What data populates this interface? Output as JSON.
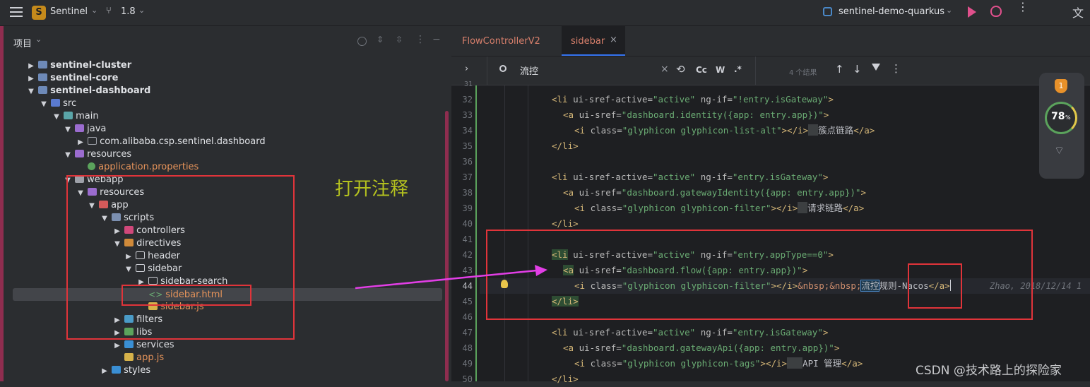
{
  "topbar": {
    "project": "Sentinel",
    "branch": "1.8",
    "run_config": "sentinel-demo-quarkus"
  },
  "project_panel": {
    "title": "项目",
    "tree": [
      {
        "label": "sentinel-cluster",
        "kind": "module"
      },
      {
        "label": "sentinel-core",
        "kind": "module"
      },
      {
        "label": "sentinel-dashboard",
        "kind": "module"
      },
      {
        "label": "src",
        "kind": "folder"
      },
      {
        "label": "main",
        "kind": "folder"
      },
      {
        "label": "java",
        "kind": "folder"
      },
      {
        "label": "com.alibaba.csp.sentinel.dashboard",
        "kind": "package"
      },
      {
        "label": "resources",
        "kind": "folder"
      },
      {
        "label": "application.properties",
        "kind": "file"
      },
      {
        "label": "webapp",
        "kind": "folder"
      },
      {
        "label": "resources",
        "kind": "folder"
      },
      {
        "label": "app",
        "kind": "folder"
      },
      {
        "label": "scripts",
        "kind": "folder"
      },
      {
        "label": "controllers",
        "kind": "folder"
      },
      {
        "label": "directives",
        "kind": "folder"
      },
      {
        "label": "header",
        "kind": "folder"
      },
      {
        "label": "sidebar",
        "kind": "folder"
      },
      {
        "label": "sidebar-search",
        "kind": "folder"
      },
      {
        "label": "sidebar.html",
        "kind": "file"
      },
      {
        "label": "sidebar.js",
        "kind": "file"
      },
      {
        "label": "filters",
        "kind": "folder"
      },
      {
        "label": "libs",
        "kind": "folder"
      },
      {
        "label": "services",
        "kind": "folder"
      },
      {
        "label": "app.js",
        "kind": "file"
      },
      {
        "label": "styles",
        "kind": "folder"
      }
    ]
  },
  "annotation": {
    "note": "打开注释"
  },
  "editor": {
    "tabs": [
      "FlowControllerV2",
      "sidebar"
    ],
    "find": {
      "query": "流控",
      "case_label": "Cc",
      "word_label": "W",
      "regex_label": ".*",
      "results": "4 个结果"
    },
    "line_numbers": [
      "31",
      "32",
      "33",
      "34",
      "35",
      "36",
      "37",
      "38",
      "39",
      "40",
      "41",
      "42",
      "43",
      "44",
      "45",
      "46",
      "47",
      "48",
      "49",
      "50"
    ],
    "lines": {
      "l32_a": "<li ",
      "l32_b": "ui-sref-active",
      "l32_c": "=",
      "l32_d": "\"active\"",
      "l32_e": " ng-if",
      "l32_f": "=",
      "l32_g": "\"!entry.isGateway\"",
      "l32_h": ">",
      "l33_a": "<a ",
      "l33_b": "ui-sref",
      "l33_c": "=",
      "l33_d": "\"dashboard.identity({app: entry.app})\"",
      "l33_e": ">",
      "l34_a": "<i ",
      "l34_b": "class",
      "l34_c": "=",
      "l34_d": "\"glyphicon glyphicon-list-alt\"",
      "l34_e": "></i>",
      "l34_f": "簇点链路",
      "l34_g": "</a>",
      "l35": "</li>",
      "l37_a": "<li ",
      "l37_b": "ui-sref-active",
      "l37_c": "=",
      "l37_d": "\"active\"",
      "l37_e": " ng-if",
      "l37_f": "=",
      "l37_g": "\"entry.isGateway\"",
      "l37_h": ">",
      "l38_a": "<a ",
      "l38_b": "ui-sref",
      "l38_c": "=",
      "l38_d": "\"dashboard.gatewayIdentity({app: entry.app})\"",
      "l38_e": ">",
      "l39_a": "<i ",
      "l39_b": "class",
      "l39_c": "=",
      "l39_d": "\"glyphicon glyphicon-filter\"",
      "l39_e": "></i>",
      "l39_f": "请求链路",
      "l39_g": "</a>",
      "l40": "</li>",
      "l42_a": "<li",
      "l42_b": " ui-sref-active",
      "l42_c": "=",
      "l42_d": "\"active\"",
      "l42_e": " ng-if",
      "l42_f": "=",
      "l42_g": "\"entry.appType==0\"",
      "l42_h": ">",
      "l43_a": "<a",
      "l43_b": " ui-sref",
      "l43_c": "=",
      "l43_d": "\"dashboard.flow({app: entry.app})\"",
      "l43_e": ">",
      "l44_a": "<i ",
      "l44_b": "class",
      "l44_c": "=",
      "l44_d": "\"glyphicon glyphicon-filter\"",
      "l44_e": "></i>",
      "l44_f": "&nbsp;&nbsp;",
      "l44_g": "流控",
      "l44_h": "规则-Nacos",
      "l44_i": "</a>",
      "l44_blame": "Zhao, 2018/12/14 1",
      "l45": "</li>",
      "l47_a": "<li ",
      "l47_b": "ui-sref-active",
      "l47_c": "=",
      "l47_d": "\"active\"",
      "l47_e": " ng-if",
      "l47_f": "=",
      "l47_g": "\"entry.isGateway\"",
      "l47_h": ">",
      "l48_a": "<a ",
      "l48_b": "ui-sref",
      "l48_c": "=",
      "l48_d": "\"dashboard.gatewayApi({app: entry.app})\"",
      "l48_e": ">",
      "l49_a": "<i ",
      "l49_b": "class",
      "l49_c": "=",
      "l49_d": "\"glyphicon glyphicon-tags\"",
      "l49_e": "></i>",
      "l49_f": "API 管理",
      "l49_g": "</a>",
      "l50": "</li>"
    }
  },
  "widget": {
    "percent": "78",
    "percent_sign": "%"
  },
  "watermark": "CSDN @技术路上的探险家"
}
